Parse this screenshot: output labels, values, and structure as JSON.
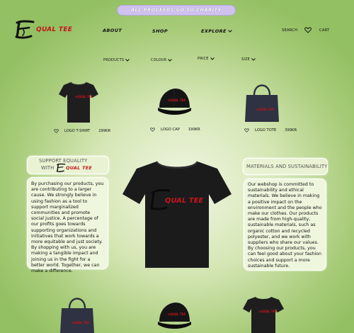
{
  "banner": {
    "text": "ALL PROCEEDS GO TO CHARITY"
  },
  "brand": {
    "logo_text": "QUAL TEE"
  },
  "nav": {
    "about": "ABOUT",
    "shop": "SHOP",
    "explore": "EXPLORE"
  },
  "utility": {
    "search": "SEARCH",
    "cart": "CART"
  },
  "filters": {
    "products": "PRODUCTS",
    "colour": "COLOUR",
    "price": "PRICE",
    "size": "SIZE"
  },
  "products": [
    {
      "name": "LOGO T-SHIRT",
      "price": "299KR"
    },
    {
      "name": "LOGO CAP",
      "price": "199KR"
    },
    {
      "name": "LOGO TOTE",
      "price": "399KR"
    }
  ],
  "left_panel": {
    "heading_line1": "SUPPORT EQUALITY",
    "heading_with": "WITH",
    "body": "By purchasing our products, you are contributing to a larger cause. We strongly believe in using fashion as a tool to support marginalized communities and promote social justice. A percentage of our profits goes towards supporting organizations and initiatives that work towards a more equitable and just society. By shopping with us, you are making a tangible impact and joining us in the fight for a better world. Together, we can make a difference."
  },
  "right_panel": {
    "heading": "MATERIALS AND SUSTAINABILITY",
    "body": "Our webshop is committed to sustainability and ethical materials. We believe in making a positive impact on the environment and the people who make our clothes. Our products are made from high-quality, sustainable materials, such as organic cotton and recycled polyester, and we work with suppliers who share our values. By choosing our products, you can feel good about your fashion choices and support a more sustainable future."
  },
  "colors": {
    "accent": "#c5141b",
    "banner": "#cfc2ee",
    "panel": "#eef6dd"
  }
}
